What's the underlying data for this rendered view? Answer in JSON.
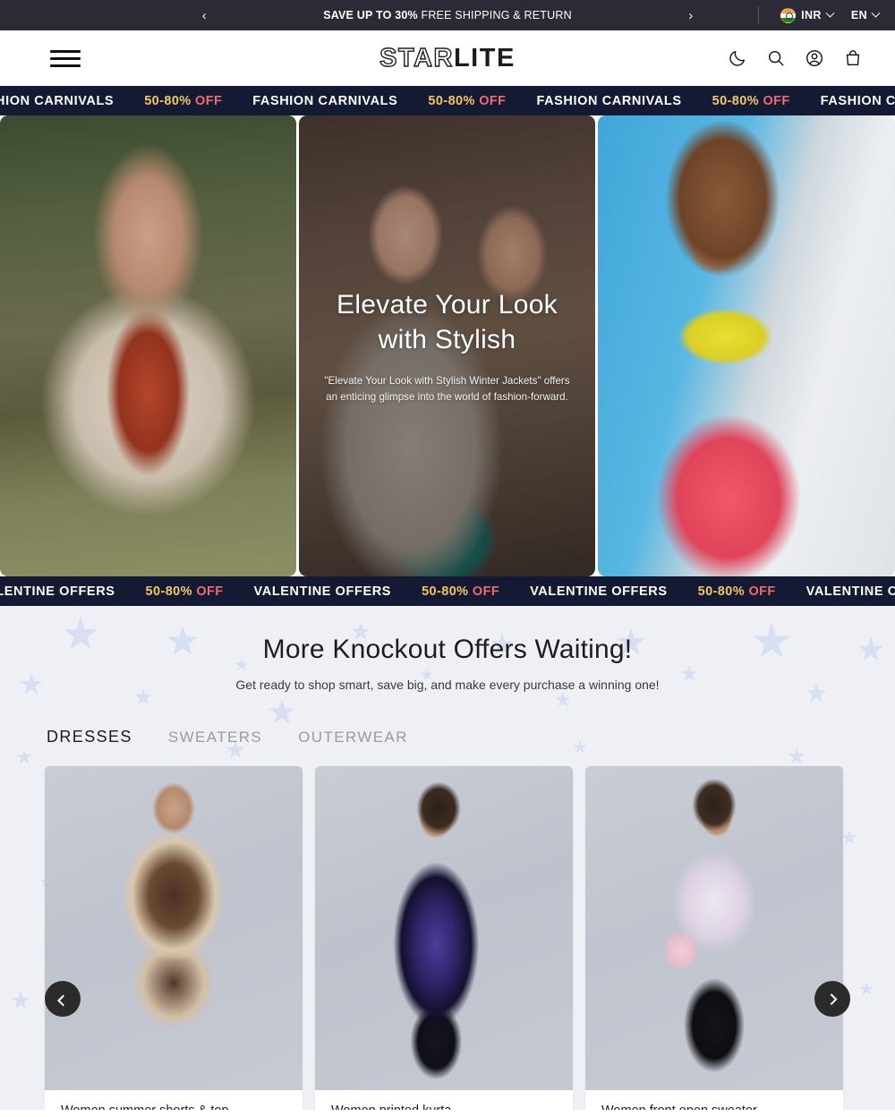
{
  "announcement": {
    "prev_icon": "chevron-left-icon",
    "next_icon": "chevron-right-icon",
    "message_bold": "SAVE UP TO 30%",
    "message_rest": " FREE SHIPPING & RETURN",
    "currency": "INR",
    "currency_flag": "india-flag-icon",
    "language": "EN"
  },
  "header": {
    "menu_icon": "hamburger-menu-icon",
    "logo_part1": "STAR",
    "logo_part2": "LITE",
    "icons": [
      "moon-icon",
      "search-icon",
      "account-icon",
      "shopping-bag-icon"
    ]
  },
  "marquee_top": {
    "label": "FASHION CARNIVALS",
    "discount_number": "50-80%",
    "discount_word": " OFF"
  },
  "marquee_bottom": {
    "label": "VALENTINE OFFERS",
    "discount_number": "50-80%",
    "discount_word": " OFF"
  },
  "hero": {
    "title": "Elevate Your Look with Stylish",
    "subtitle": "\"Elevate Your Look with Stylish Winter Jackets\" offers an enticing glimpse into the world of fashion-forward.",
    "slides": [
      "outdoor-plaid-jacket-slide",
      "street-style-couple-slide",
      "summer-beachwear-slide"
    ]
  },
  "offers": {
    "heading": "More Knockout Offers Waiting!",
    "subheading": "Get ready to shop smart, save big, and make every purchase a winning one!",
    "tabs": [
      {
        "label": "DRESSES",
        "active": true
      },
      {
        "label": "SWEATERS",
        "active": false
      },
      {
        "label": "OUTERWEAR",
        "active": false
      }
    ],
    "products": [
      {
        "name": "Women summer shorts & top"
      },
      {
        "name": "Women printed kurta"
      },
      {
        "name": "Women front open sweater"
      }
    ],
    "prev_icon": "chevron-left-icon",
    "next_icon": "chevron-right-icon"
  },
  "colors": {
    "announce_bg": "#2b2a35",
    "marquee_bg": "#141a33",
    "marquee_number": "#f2c75c",
    "marquee_word": "#f06a6a",
    "offers_bg": "#eef0f6",
    "star": "#d6e0f2",
    "carousel_button": "#2b2b2b"
  }
}
